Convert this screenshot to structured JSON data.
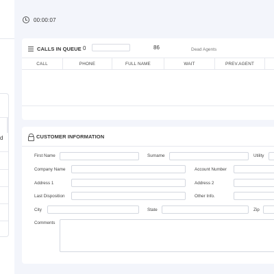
{
  "timer": {
    "value": "00:00:07",
    "icon": "clock-icon"
  },
  "sidebar": {
    "partial_text": "d"
  },
  "queue": {
    "icon": "menu-icon",
    "title": "CALLS IN QUEUE",
    "count": "0",
    "filter_value": "",
    "agents_count": "86",
    "dead_agents_label": "Dead Agents",
    "columns": [
      "CALL",
      "PHONE",
      "FULL NAME",
      "WAIT",
      "PREV.AGENT",
      ""
    ],
    "rows": []
  },
  "customer": {
    "icon": "lock-icon",
    "title": "CUSTOMER INFORMATION",
    "fields": {
      "first_name": {
        "label": "First Name",
        "value": ""
      },
      "surname": {
        "label": "Surname",
        "value": ""
      },
      "utility": {
        "label": "Utility",
        "value": ""
      },
      "company_name": {
        "label": "Company Name",
        "value": ""
      },
      "account_number": {
        "label": "Account Number",
        "value": ""
      },
      "address1": {
        "label": "Address 1",
        "value": ""
      },
      "address2": {
        "label": "Address 2",
        "value": ""
      },
      "last_disposition": {
        "label": "Last Disposition",
        "value": ""
      },
      "other_info": {
        "label": "Other Info.",
        "value": ""
      },
      "city": {
        "label": "City",
        "value": ""
      },
      "state": {
        "label": "State",
        "value": ""
      },
      "zip": {
        "label": "Zip",
        "value": ""
      },
      "comments": {
        "label": "Comments",
        "value": ""
      }
    }
  }
}
